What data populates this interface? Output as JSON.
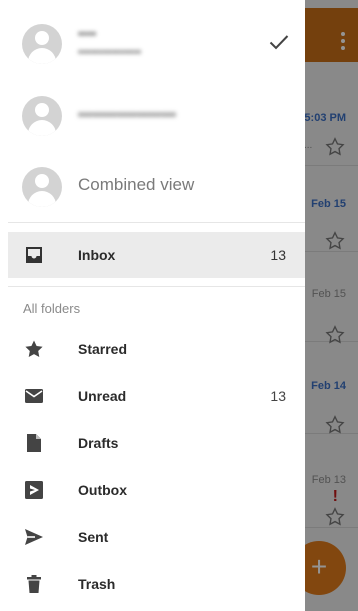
{
  "background": {
    "dates": [
      "5:03 PM",
      "Feb 15",
      "Feb 15",
      "Feb 14",
      "Feb 13"
    ],
    "fab_label": "+"
  },
  "drawer": {
    "accounts": [
      {
        "name": "••••",
        "email": "•••••••••••••••",
        "selected": true
      },
      {
        "email": "••••••••••••••••••••"
      }
    ],
    "combined_view": "Combined view",
    "inbox": {
      "label": "Inbox",
      "count": "13"
    },
    "section_title": "All folders",
    "folders": [
      {
        "icon": "star-icon",
        "label": "Starred",
        "count": ""
      },
      {
        "icon": "envelope-icon",
        "label": "Unread",
        "count": "13"
      },
      {
        "icon": "draft-file-icon",
        "label": "Drafts",
        "count": ""
      },
      {
        "icon": "outbox-icon",
        "label": "Outbox",
        "count": ""
      },
      {
        "icon": "send-icon",
        "label": "Sent",
        "count": ""
      },
      {
        "icon": "trash-icon",
        "label": "Trash",
        "count": ""
      }
    ]
  },
  "colors": {
    "appbar": "#c86f18",
    "fab": "#e07a1a",
    "date_accent": "#3b6fc3",
    "icon": "#444444"
  }
}
